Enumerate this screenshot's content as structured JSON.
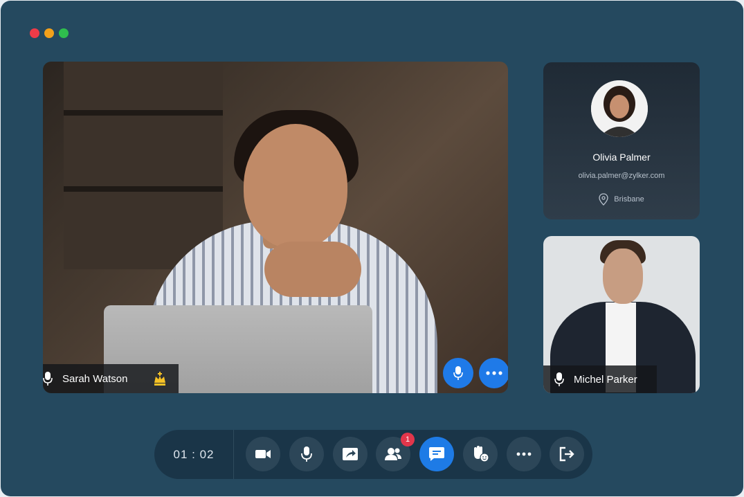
{
  "window": {
    "controls": [
      "close",
      "minimize",
      "maximize"
    ]
  },
  "main_video": {
    "participant_name": "Sarah Watson",
    "host_icon": "crown-icon",
    "mic_button_icon": "microphone-icon",
    "more_button_icon": "ellipsis-icon"
  },
  "profile_card": {
    "name": "Olivia Palmer",
    "email": "olivia.palmer@zylker.com",
    "location": "Brisbane"
  },
  "second_video": {
    "participant_name": "Michel Parker"
  },
  "control_bar": {
    "timer": "01 : 02",
    "participants_badge": "1",
    "buttons": [
      "video-camera",
      "microphone",
      "share-screen",
      "participants",
      "chat",
      "raise-hand",
      "more",
      "leave"
    ]
  },
  "colors": {
    "window_bg": "#25495f",
    "accent_blue": "#1e7be6",
    "badge_red": "#e2364b",
    "control_bar_bg": "#1a3548"
  }
}
